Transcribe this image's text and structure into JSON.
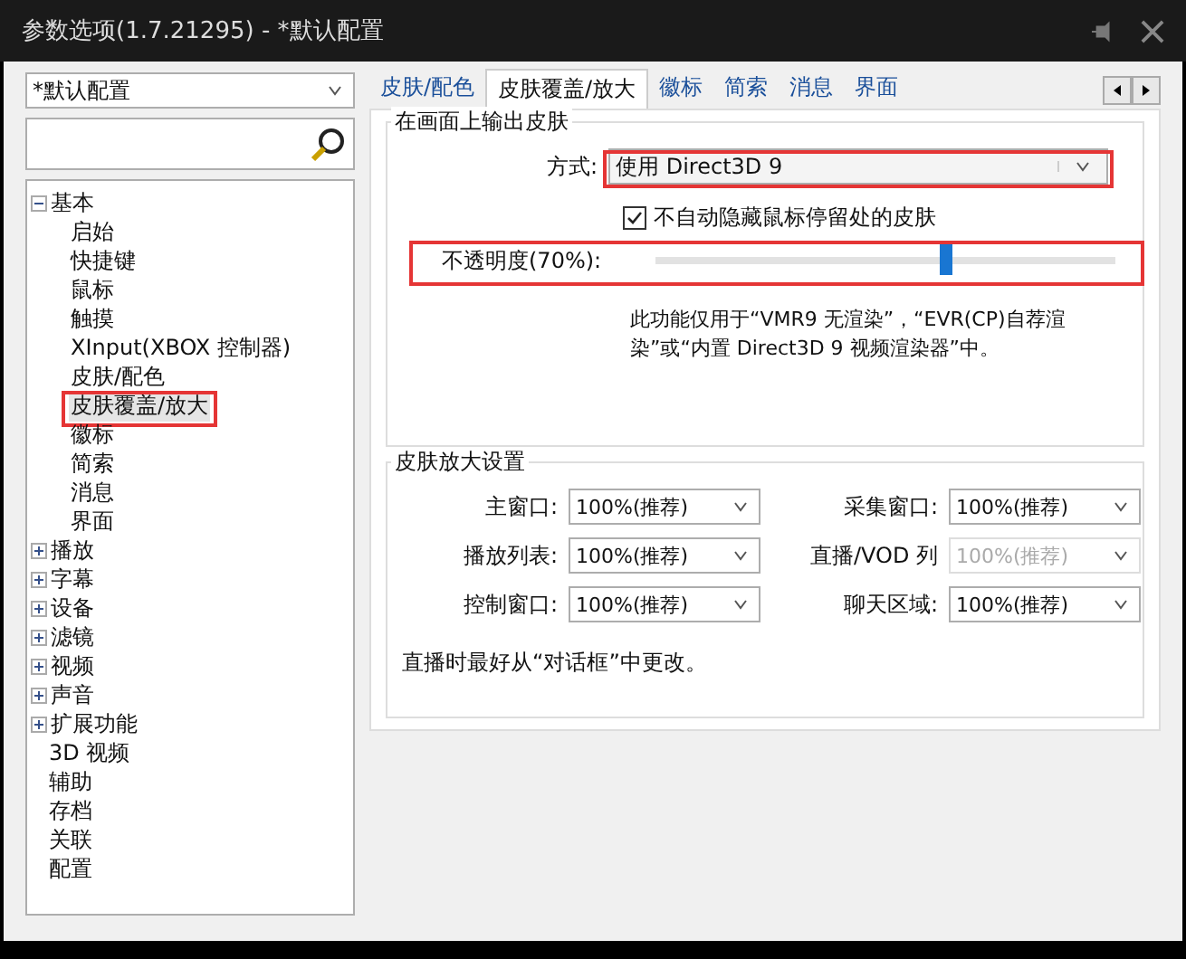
{
  "window": {
    "title": "参数选项(1.7.21295) - *默认配置"
  },
  "profile": {
    "value": "*默认配置"
  },
  "tree": [
    {
      "label": "基本",
      "expanded": true,
      "selected": false,
      "children": [
        {
          "label": "启始",
          "selected": false
        },
        {
          "label": "快捷键",
          "selected": false
        },
        {
          "label": "鼠标",
          "selected": false
        },
        {
          "label": "触摸",
          "selected": false
        },
        {
          "label": "XInput(XBOX 控制器)",
          "selected": false
        },
        {
          "label": "皮肤/配色",
          "selected": false
        },
        {
          "label": "皮肤覆盖/放大",
          "selected": true,
          "highlighted": true
        },
        {
          "label": "徽标",
          "selected": false
        },
        {
          "label": "简索",
          "selected": false
        },
        {
          "label": "消息",
          "selected": false
        },
        {
          "label": "界面",
          "selected": false
        }
      ]
    },
    {
      "label": "播放",
      "expanded": false,
      "selected": false
    },
    {
      "label": "字幕",
      "expanded": false,
      "selected": false
    },
    {
      "label": "设备",
      "expanded": false,
      "selected": false
    },
    {
      "label": "滤镜",
      "expanded": false,
      "selected": false
    },
    {
      "label": "视频",
      "expanded": false,
      "selected": false
    },
    {
      "label": "声音",
      "expanded": false,
      "selected": false
    },
    {
      "label": "扩展功能",
      "expanded": false,
      "selected": false
    },
    {
      "label": "3D 视频",
      "selected": false
    },
    {
      "label": "辅助",
      "selected": false
    },
    {
      "label": "存档",
      "selected": false
    },
    {
      "label": "关联",
      "selected": false
    },
    {
      "label": "配置",
      "selected": false
    }
  ],
  "tabs": [
    {
      "label": "皮肤/配色",
      "selected": false
    },
    {
      "label": "皮肤覆盖/放大",
      "selected": true
    },
    {
      "label": "徽标",
      "selected": false
    },
    {
      "label": "简索",
      "selected": false
    },
    {
      "label": "消息",
      "selected": false
    },
    {
      "label": "界面",
      "selected": false
    }
  ],
  "output_group": {
    "title": "在画面上输出皮肤",
    "method": {
      "label": "方式:",
      "value": "使用 Direct3D 9",
      "highlighted": true
    },
    "checkbox": {
      "label": "不自动隐藏鼠标停留处的皮肤",
      "checked": true
    },
    "opacity": {
      "label": "不透明度(70%):",
      "level": 0.63,
      "highlighted": true
    },
    "note": "此功能仅用于“VMR9 无渲染”，“EVR(CP)自荐渲染”或“内置 Direct3D 9 视频渲染器”中。"
  },
  "scale_group": {
    "title": "皮肤放大设置",
    "fields": [
      {
        "label": "主窗口:",
        "value": "100%(推荐)",
        "disabled": false
      },
      {
        "label": "采集窗口:",
        "value": "100%(推荐)",
        "disabled": false
      },
      {
        "label": "播放列表:",
        "value": "100%(推荐)",
        "disabled": false
      },
      {
        "label": "直播/VOD 列",
        "value": "100%(推荐)",
        "disabled": true
      },
      {
        "label": "控制窗口:",
        "value": "100%(推荐)",
        "disabled": false
      },
      {
        "label": "聊天区域:",
        "value": "100%(推荐)",
        "disabled": false
      }
    ],
    "note": "直播时最好从“对话框”中更改。"
  }
}
